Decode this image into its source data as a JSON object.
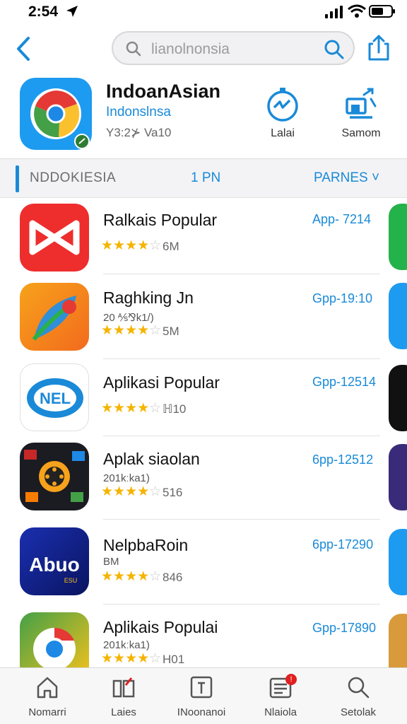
{
  "status_bar": {
    "time": "2:54"
  },
  "search": {
    "query": "lianolnonsia"
  },
  "app_header": {
    "title": "IndoanAsian",
    "subtitle": "Indonslnsa",
    "meta": "Y3:2⊁ Va10",
    "actions": [
      {
        "label": "Lalai",
        "icon": "stopwatch-icon"
      },
      {
        "label": "Samom",
        "icon": "share-chart-icon"
      }
    ]
  },
  "section": {
    "left": "NDDOKIESIA",
    "center": "1 PN",
    "right": "PARNES ˅"
  },
  "apps": [
    {
      "name": "Ralkais Popular",
      "sub": "",
      "rating": 3.5,
      "stars": "★★★★",
      "size": "6M",
      "code": "App- 7214"
    },
    {
      "name": "Raghking Jn",
      "sub": "20 ⅍⅋k1/)",
      "rating": 3.5,
      "stars": "★★★★",
      "size": "5M",
      "code": "Gpp-19:10"
    },
    {
      "name": "Aplikasi Popular",
      "sub": "",
      "rating": 3.5,
      "stars": "★★★★",
      "size": "ℍ10",
      "code": "Gpp-12514"
    },
    {
      "name": "Aplak siaolan",
      "sub": "201kːka1)",
      "rating": 4.0,
      "stars": "★★★★",
      "size": "516",
      "code": "6pp-12512"
    },
    {
      "name": "NelpbaRoin",
      "sub": "BM",
      "rating": 4.0,
      "stars": "★★★★",
      "size": "846",
      "code": "6pp-17290"
    },
    {
      "name": "Aplikais Populai",
      "sub": "201kːka1)",
      "rating": 4.0,
      "stars": "★★★★",
      "size": "H01",
      "code": "Gpp-17890"
    }
  ],
  "icon_labels": {
    "nel": "NEL",
    "abuo": "Abuo",
    "abuo_small": "ESU"
  },
  "tabs": [
    {
      "label": "Nomarri",
      "icon": "home-icon"
    },
    {
      "label": "Laies",
      "icon": "apps-icon"
    },
    {
      "label": "INoonanoi",
      "icon": "info-card-icon"
    },
    {
      "label": "Nlaiola",
      "icon": "news-icon",
      "badge": "!"
    },
    {
      "label": "Setolak",
      "icon": "search-icon"
    }
  ],
  "colors": {
    "accent": "#1a8ad8",
    "star": "#f5b400"
  }
}
